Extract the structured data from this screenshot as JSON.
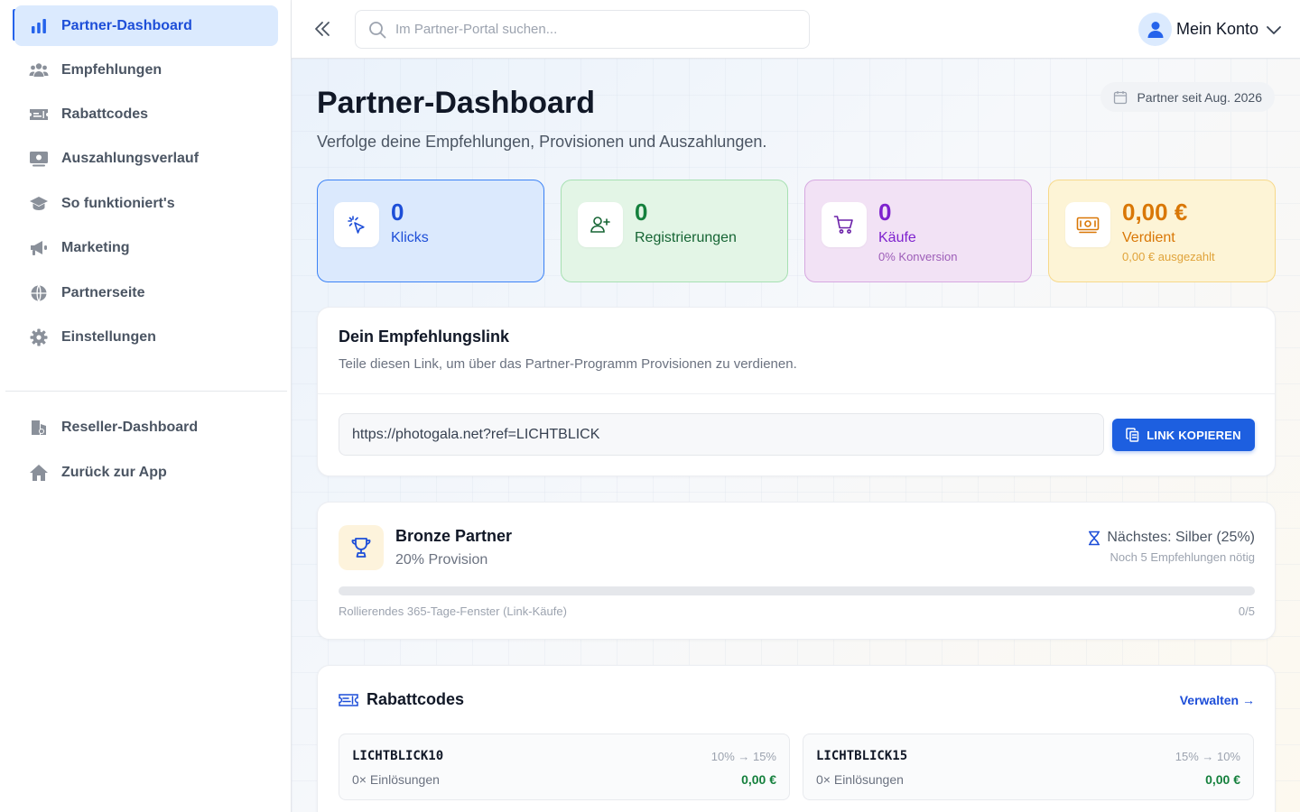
{
  "sidebar": {
    "items": [
      {
        "label": "Partner-Dashboard",
        "icon": "bar-chart-icon",
        "active": true
      },
      {
        "label": "Empfehlungen",
        "icon": "users-icon"
      },
      {
        "label": "Rabattcodes",
        "icon": "ticket-icon"
      },
      {
        "label": "Auszahlungsverlauf",
        "icon": "payout-icon"
      },
      {
        "label": "So funktioniert's",
        "icon": "graduation-cap-icon"
      },
      {
        "label": "Marketing",
        "icon": "megaphone-icon"
      },
      {
        "label": "Partnerseite",
        "icon": "globe-icon"
      },
      {
        "label": "Einstellungen",
        "icon": "gear-icon"
      }
    ],
    "secondary": [
      {
        "label": "Reseller-Dashboard",
        "icon": "reseller-icon"
      },
      {
        "label": "Zurück zur App",
        "icon": "home-icon"
      }
    ]
  },
  "header": {
    "search_placeholder": "Im Partner-Portal suchen...",
    "account_label": "Mein Konto"
  },
  "page": {
    "title": "Partner-Dashboard",
    "subtitle": "Verfolge deine Empfehlungen, Provisionen und Auszahlungen.",
    "partner_since": "Partner seit Aug. 2026"
  },
  "stats": [
    {
      "value": "0",
      "label": "Klicks",
      "sub": ""
    },
    {
      "value": "0",
      "label": "Registrierungen",
      "sub": ""
    },
    {
      "value": "0",
      "label": "Käufe",
      "sub": "0% Konversion"
    },
    {
      "value": "0,00 €",
      "label": "Verdient",
      "sub": "0,00 € ausgezahlt"
    }
  ],
  "referral": {
    "title": "Dein Empfehlungslink",
    "description": "Teile diesen Link, um über das Partner-Programm Provisionen zu verdienen.",
    "link": "https://photogala.net?ref=LICHTBLICK",
    "copy_label": "LINK KOPIEREN"
  },
  "tier": {
    "name": "Bronze Partner",
    "provision": "20% Provision",
    "next": "Nächstes: Silber (25%)",
    "next_need": "Noch 5 Empfehlungen nötig",
    "window_label": "Rollierendes 365-Tage-Fenster (Link-Käufe)",
    "count_label": "0/5",
    "progress": 0
  },
  "codes": {
    "title": "Rabattcodes",
    "manage_label": "Verwalten →",
    "items": [
      {
        "code": "LICHTBLICK10",
        "redemptions": "0× Einlösungen",
        "split": "10% → 15%",
        "amount": "0,00 €"
      },
      {
        "code": "LICHTBLICK15",
        "redemptions": "0× Einlösungen",
        "split": "15% → 10%",
        "amount": "0,00 €"
      }
    ]
  },
  "colors": {
    "accent": "#1d5fe0",
    "active_bg": "#dbeafe",
    "success": "#15803d",
    "earned": "#d97706",
    "purple": "#7e22ce"
  }
}
